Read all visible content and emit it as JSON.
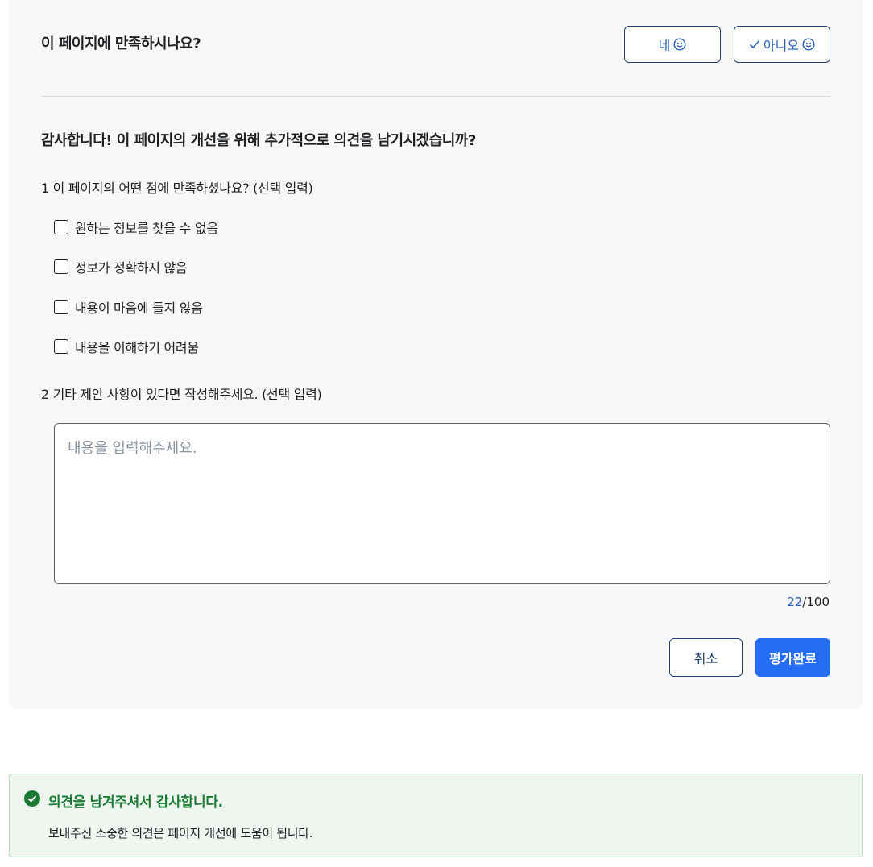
{
  "survey": {
    "question": "이 페이지에 만족하시나요?",
    "yes_label": "네",
    "no_label": "아니오",
    "thanks_prompt": "감사합니다! 이 페이지의 개선을 위해 추가적으로 의견을 남기시겠습니까?",
    "q1_label": "1 이 페이지의 어떤 점에 만족하셨나요? (선택 입력)",
    "options": [
      "원하는 정보를 찾을 수 없음",
      "정보가 정확하지 않음",
      "내용이 마음에 들지 않음",
      "내용을 이해하기 어려움"
    ],
    "q2_label": "2 기타 제안 사항이 있다면 작성해주세요. (선택 입력)",
    "textarea_placeholder": "내용을 입력해주세요.",
    "char_count": "22",
    "char_max": "/100",
    "cancel_label": "취소",
    "submit_label": "평가완료"
  },
  "alert": {
    "title": "의견을 남겨주셔서 감사합니다.",
    "body": "보내주신 소중한 의견은 페이지 개선에 도움이 됩니다.",
    "color": "#1a7a34"
  },
  "colors": {
    "accent": "#256ef4",
    "outline": "#21416f",
    "link": "#2360b8"
  }
}
